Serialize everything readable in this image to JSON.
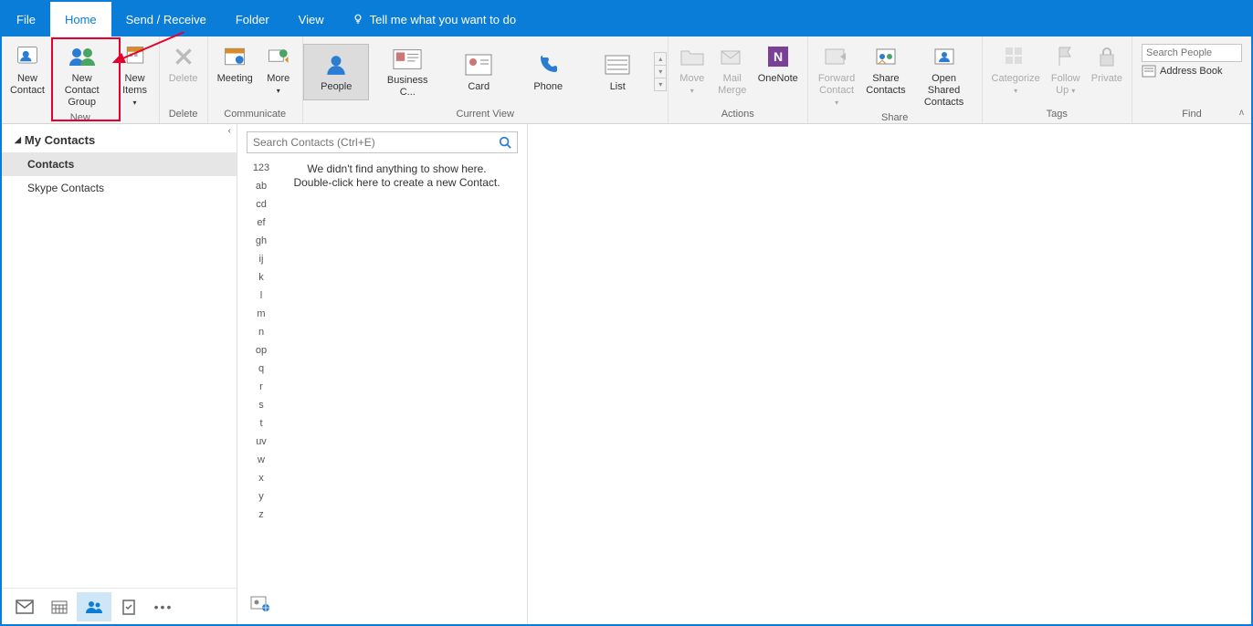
{
  "tabs": {
    "file": "File",
    "home": "Home",
    "send": "Send / Receive",
    "folder": "Folder",
    "view": "View",
    "tellme": "Tell me what you want to do"
  },
  "ribbon": {
    "new": {
      "label": "New",
      "new_contact": "New\nContact",
      "new_group": "New Contact\nGroup",
      "new_items": "New\nItems"
    },
    "delete": {
      "label": "Delete",
      "delete": "Delete"
    },
    "communicate": {
      "label": "Communicate",
      "meeting": "Meeting",
      "more": "More"
    },
    "currentview": {
      "label": "Current View",
      "people": "People",
      "business": "Business C...",
      "card": "Card",
      "phone": "Phone",
      "list": "List"
    },
    "actions": {
      "label": "Actions",
      "move": "Move",
      "mail": "Mail\nMerge",
      "onenote": "OneNote"
    },
    "share": {
      "label": "Share",
      "forward": "Forward\nContact",
      "share": "Share\nContacts",
      "open": "Open Shared\nContacts"
    },
    "tags": {
      "label": "Tags",
      "categorize": "Categorize",
      "followup": "Follow\nUp",
      "private": "Private"
    },
    "find": {
      "label": "Find",
      "search_ph": "Search People",
      "addrbook": "Address Book"
    }
  },
  "nav": {
    "header": "My Contacts",
    "items": [
      "Contacts",
      "Skype Contacts"
    ]
  },
  "mid": {
    "search_ph": "Search Contacts (Ctrl+E)",
    "empty1": "We didn't find anything to show here.",
    "empty2": "Double-click here to create a new Contact.",
    "alpha": [
      "123",
      "ab",
      "cd",
      "ef",
      "gh",
      "ij",
      "k",
      "l",
      "m",
      "n",
      "op",
      "q",
      "r",
      "s",
      "t",
      "uv",
      "w",
      "x",
      "y",
      "z"
    ]
  }
}
